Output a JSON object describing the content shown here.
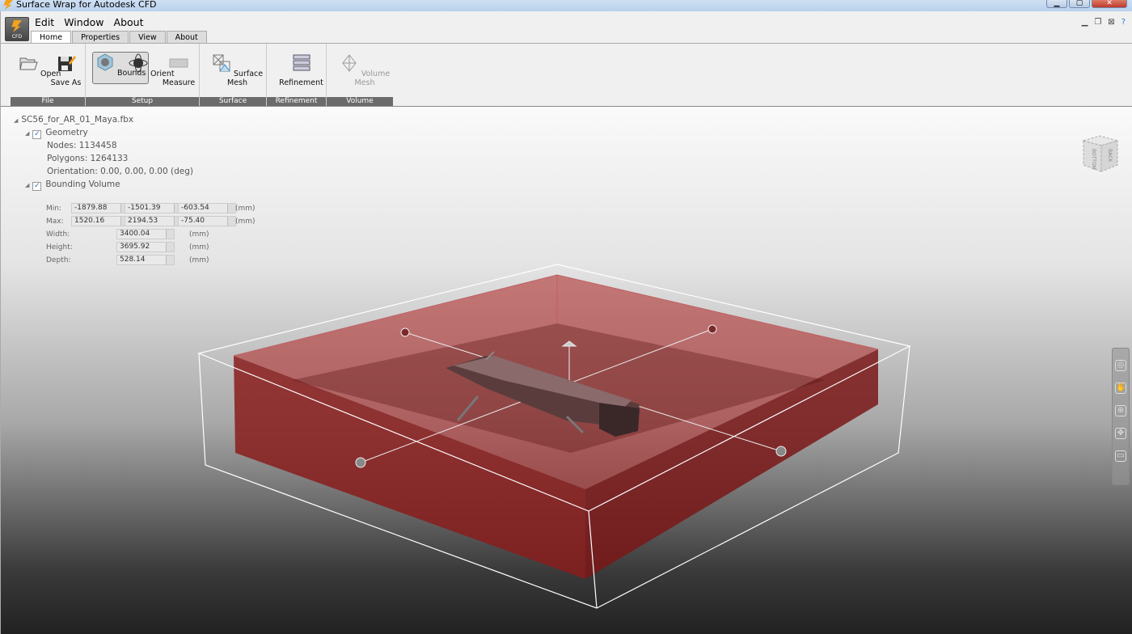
{
  "window": {
    "title": "Surface Wrap for Autodesk CFD"
  },
  "app_button": {
    "label": "CFD"
  },
  "menu": [
    "Edit",
    "Window",
    "About"
  ],
  "tabs": [
    {
      "label": "Home",
      "active": true
    },
    {
      "label": "Properties"
    },
    {
      "label": "View"
    },
    {
      "label": "About"
    }
  ],
  "ribbon": {
    "groups": [
      "File",
      "Setup",
      "Surface",
      "Refinement",
      "Volume"
    ],
    "buttons": {
      "open": "Open",
      "save_as": "Save As",
      "bounds": "Bounds",
      "orient": "Orient",
      "measure": "Measure",
      "surface_mesh": "Surface Mesh",
      "refinement": "Refinement",
      "volume_mesh": "Volume Mesh"
    }
  },
  "tree": {
    "file": "SC56_for_AR_01_Maya.fbx",
    "geometry": {
      "label": "Geometry",
      "checked": true,
      "nodes": "Nodes: 1134458",
      "polygons": "Polygons: 1264133",
      "orientation": "Orientation: 0.00, 0.00, 0.00 (deg)"
    },
    "bounding_volume": {
      "label": "Bounding Volume",
      "checked": true,
      "min_label": "Min:",
      "min": [
        "-1879.88",
        "-1501.39",
        "-603.54"
      ],
      "max_label": "Max:",
      "max": [
        "1520.16",
        "2194.53",
        "-75.40"
      ],
      "width_label": "Width:",
      "width": "3400.04",
      "height_label": "Height:",
      "height": "3695.92",
      "depth_label": "Depth:",
      "depth": "528.14",
      "unit": "(mm)"
    }
  },
  "viewcube": {
    "faces": [
      "BOTTOM",
      "BACK"
    ]
  },
  "colors": {
    "bounds_fill": "#b03030",
    "wire": "#ffffff"
  }
}
